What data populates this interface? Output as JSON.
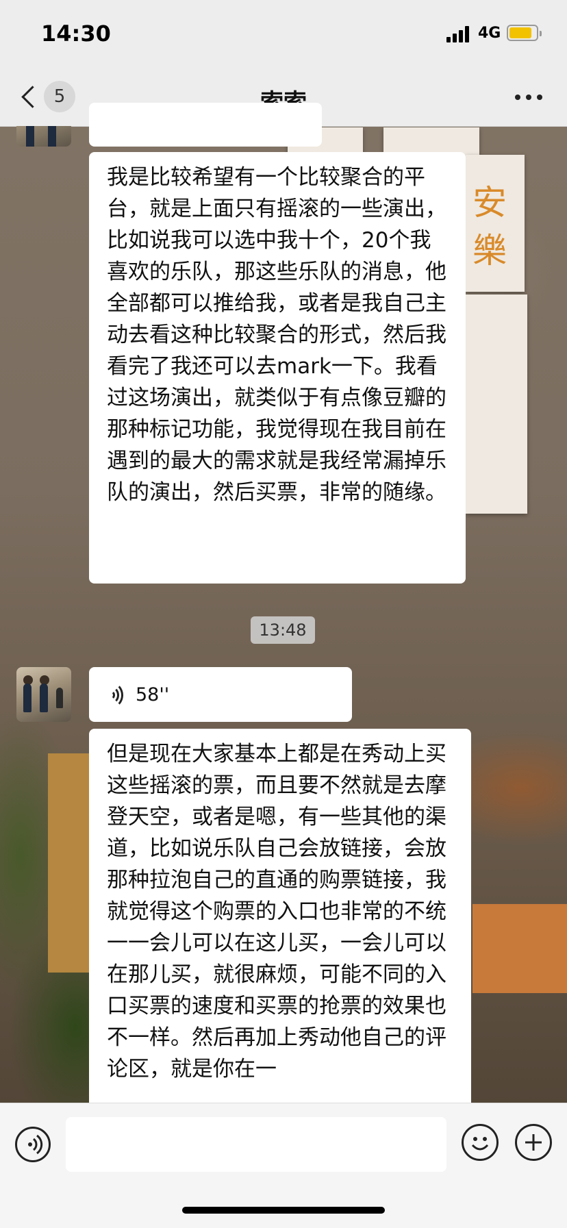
{
  "status_bar": {
    "time": "14:30",
    "network": "4G"
  },
  "nav": {
    "back_count": "5",
    "title": "索索"
  },
  "messages": {
    "msg1_text": "我是比较希望有一个比较聚合的平台，就是上面只有摇滚的一些演出，比如说我可以选中我十个，20个我喜欢的乐队，那这些乐队的消息，他全部都可以推给我，或者是我自己主动去看这种比较聚合的形式，然后我看完了我还可以去mark一下。我看过这场演出，就类似于有点像豆瓣的那种标记功能，我觉得现在我目前在遇到的最大的需求就是我经常漏掉乐队的演出，然后买票，非常的随缘。",
    "timestamp": "13:48",
    "voice_duration": "58''",
    "msg2_text": "但是现在大家基本上都是在秀动上买这些摇滚的票，而且要不然就是去摩登天空，或者是嗯，有一些其他的渠道，比如说乐队自己会放链接，会放那种拉泡自己的直通的购票链接，我就觉得这个购票的入口也非常的不统一一会儿可以在这儿买，一会儿可以在那儿买，就很麻烦，可能不同的入口买票的速度和买票的抢票的效果也不一样。然后再加上秀动他自己的评论区，就是你在一"
  },
  "wallpaper_poster_chars": [
    "安",
    "樂"
  ],
  "icons": {
    "back": "chevron-left-icon",
    "more": "more-dots-icon",
    "voice_toggle": "voice-icon",
    "emoji": "emoji-icon",
    "plus": "plus-icon"
  },
  "colors": {
    "battery": "#f2c200",
    "bubble": "#ffffff",
    "bar": "#ededed"
  }
}
